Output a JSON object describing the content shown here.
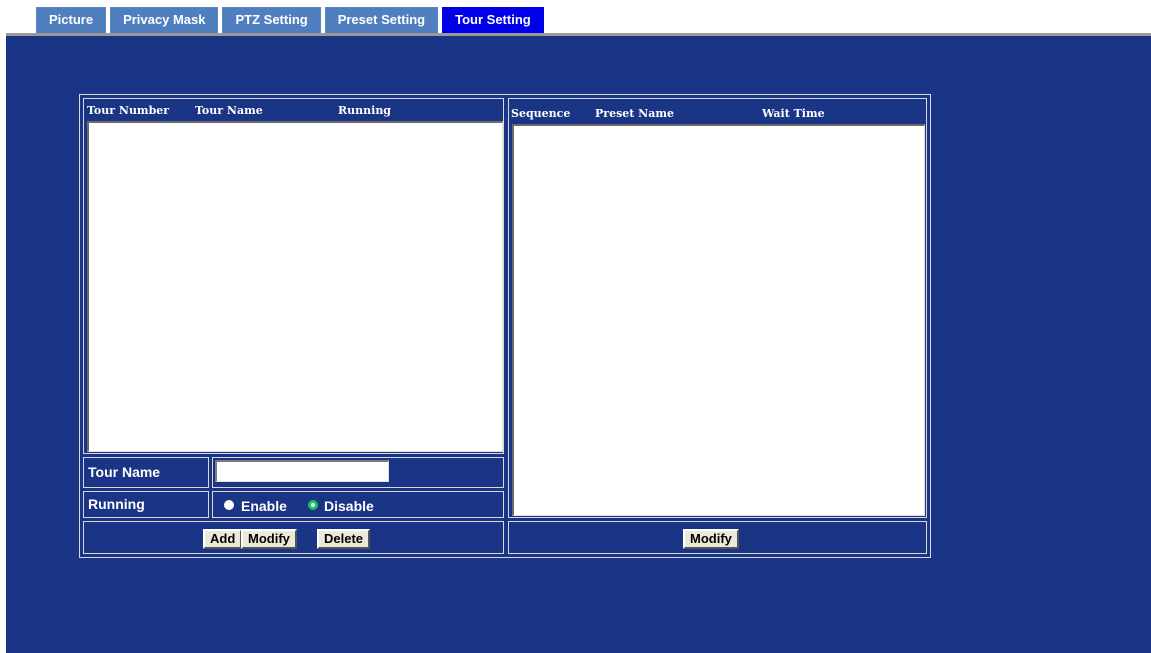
{
  "tabs": [
    {
      "label": "Picture",
      "active": false
    },
    {
      "label": "Privacy Mask",
      "active": false
    },
    {
      "label": "PTZ Setting",
      "active": false
    },
    {
      "label": "Preset Setting",
      "active": false
    },
    {
      "label": "Tour Setting",
      "active": true
    }
  ],
  "tour_list": {
    "columns": [
      "Tour Number",
      "Tour Name",
      "Running"
    ],
    "rows": []
  },
  "sequence_list": {
    "columns": [
      "Sequence",
      "Preset Name",
      "Wait Time"
    ],
    "rows": []
  },
  "form": {
    "tour_name_label": "Tour Name",
    "tour_name_value": "",
    "running_label": "Running",
    "running_options": [
      "Enable",
      "Disable"
    ],
    "running_selected": "Disable"
  },
  "buttons": {
    "add": "Add",
    "modify": "Modify",
    "delete": "Delete",
    "sequence_modify": "Modify"
  },
  "colors": {
    "background": "#1a3585",
    "tab": "#4f7fbf",
    "tab_active": "#0000e8",
    "radio_selected": "#17c35a"
  }
}
